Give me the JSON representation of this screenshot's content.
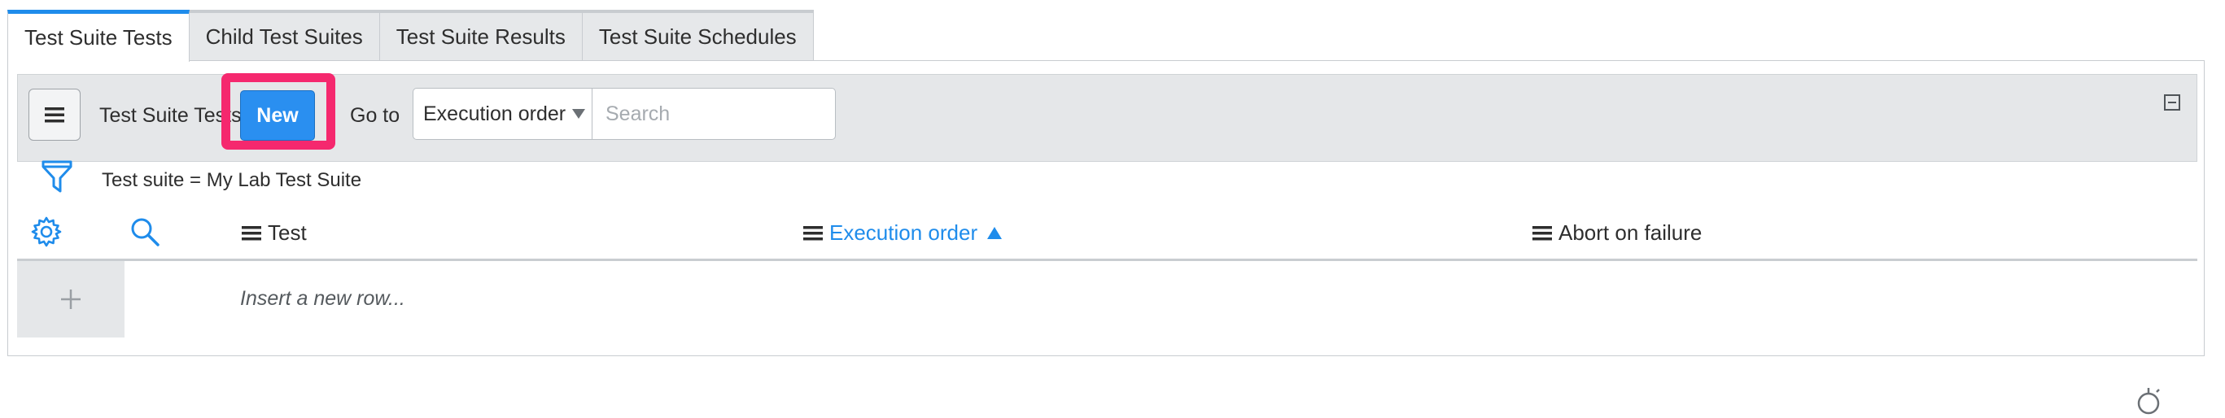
{
  "tabs": [
    {
      "label": "Test Suite Tests",
      "active": true
    },
    {
      "label": "Child Test Suites",
      "active": false
    },
    {
      "label": "Test Suite Results",
      "active": false
    },
    {
      "label": "Test Suite Schedules",
      "active": false
    }
  ],
  "toolbar": {
    "title": "Test Suite Tests",
    "new_label": "New",
    "goto_label": "Go to",
    "goto_field": "Execution order",
    "search_placeholder": "Search"
  },
  "filter": {
    "text": "Test suite = My Lab Test Suite"
  },
  "columns": [
    {
      "label": "Test",
      "sorted": false
    },
    {
      "label": "Execution order",
      "sorted": true,
      "sort_direction": "ascending"
    },
    {
      "label": "Abort on failure",
      "sorted": false
    }
  ],
  "insert_row_label": "Insert a new row...",
  "colors": {
    "accent": "#1f8ceb",
    "new_button": "#2a8ff0",
    "highlight": "#f5286e",
    "toolbar_bg": "#e5e7e9"
  },
  "icons": [
    "menu-icon",
    "collapse-icon",
    "filter-icon",
    "gear-icon",
    "search-icon",
    "plus-icon"
  ]
}
